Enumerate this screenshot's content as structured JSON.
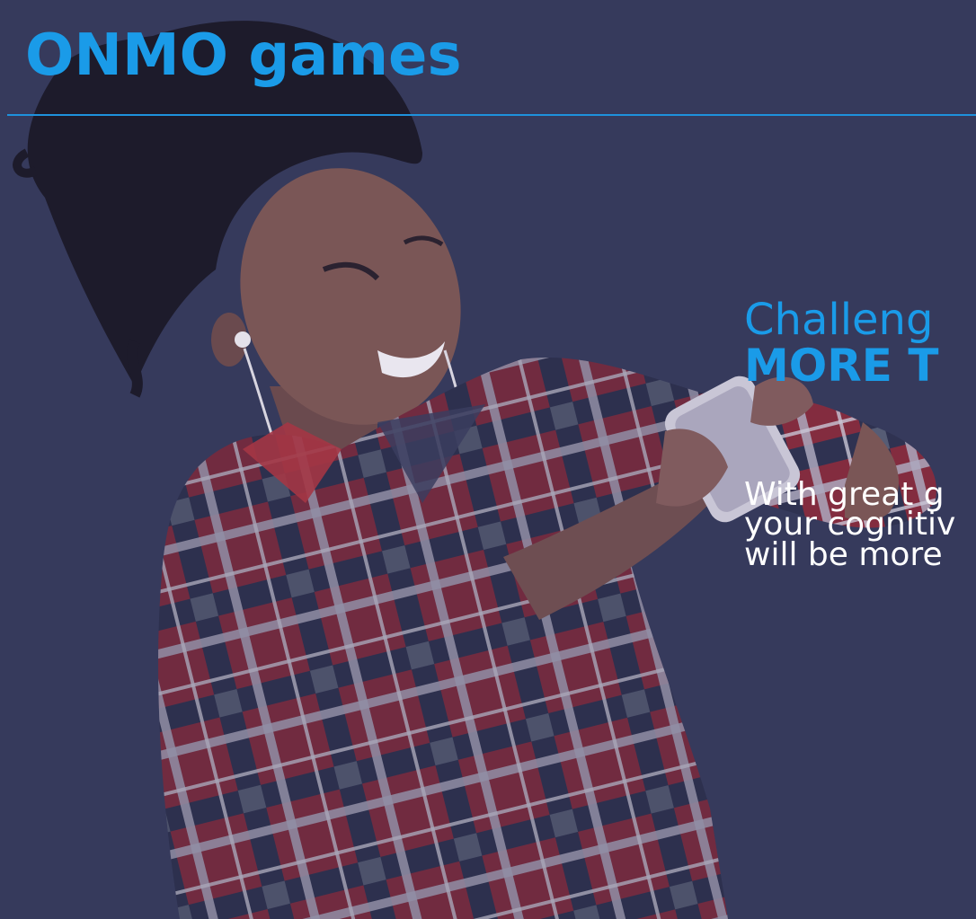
{
  "brand": {
    "title": "ONMO games"
  },
  "hero": {
    "headline_light": "Challeng",
    "headline_bold": "MORE T",
    "body_lines": [
      "With great g",
      "your cognitiv",
      "will be more"
    ]
  },
  "colors": {
    "background": "#363a5c",
    "accent": "#1a9be8",
    "body_text": "#ffffff",
    "shirt_red": "#8c2a3c",
    "shirt_navy": "#2e3150",
    "skin": "#7a5656",
    "hair": "#1d1b2b"
  }
}
